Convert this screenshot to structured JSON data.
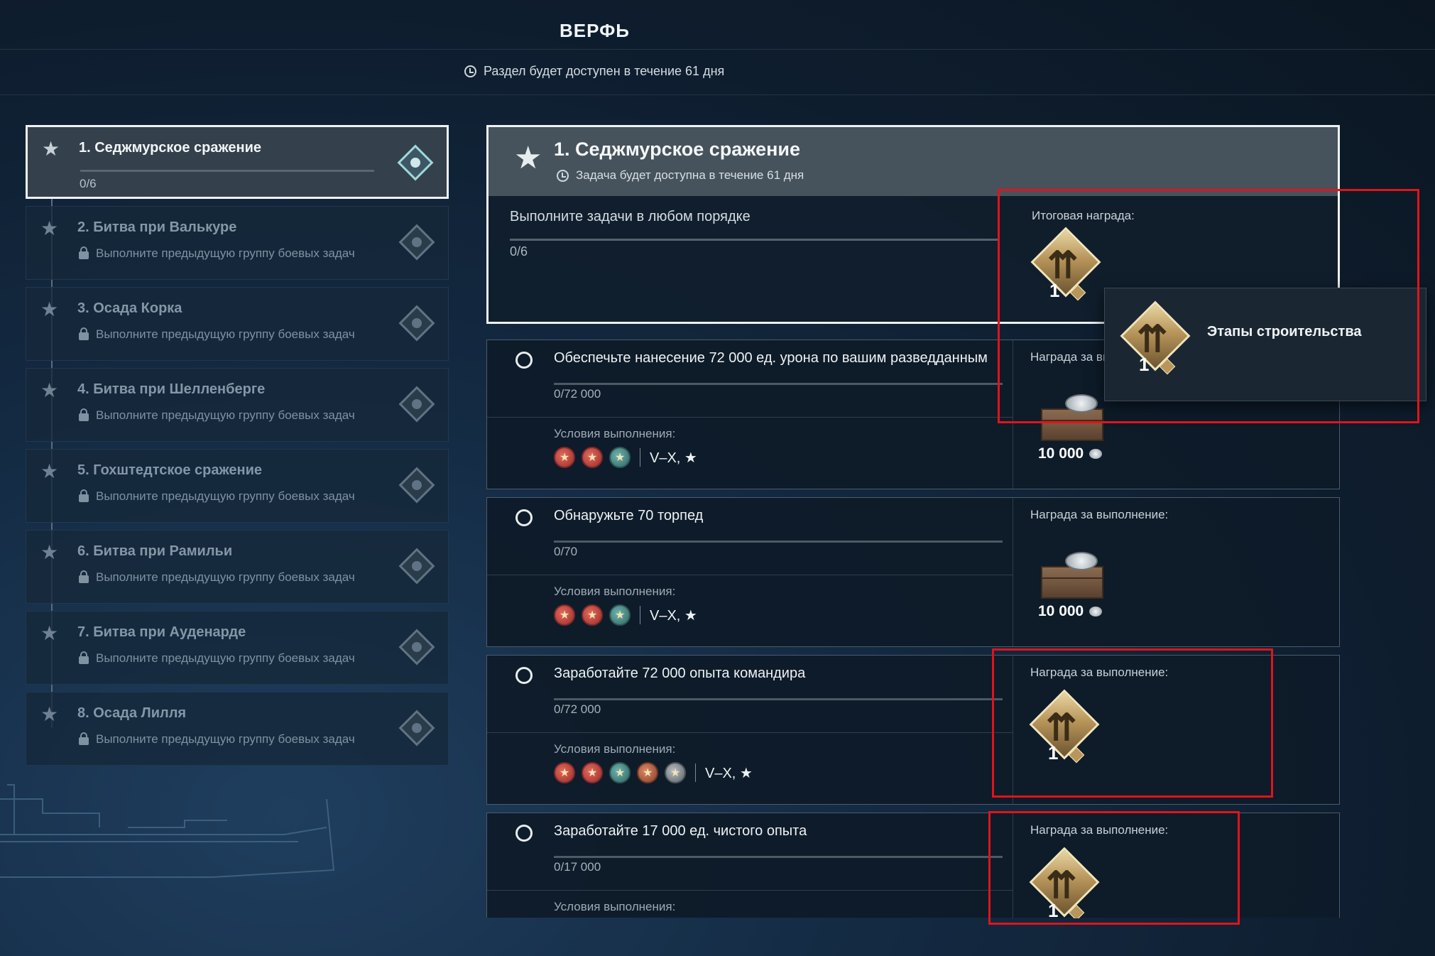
{
  "header": {
    "title": "ВЕРФЬ",
    "availability": "Раздел будет доступен в течение 61 дня"
  },
  "stages": [
    {
      "title": "1. Седжмурское сражение",
      "progress": "0/6",
      "progress_fraction": 0,
      "locked": false,
      "active": true,
      "lock_text": ""
    },
    {
      "title": "2. Битва при Валькуре",
      "progress": "",
      "locked": true,
      "active": false,
      "lock_text": "Выполните предыдущую группу боевых задач"
    },
    {
      "title": "3. Осада Корка",
      "progress": "",
      "locked": true,
      "active": false,
      "lock_text": "Выполните предыдущую группу боевых задач"
    },
    {
      "title": "4. Битва при Шелленберге",
      "progress": "",
      "locked": true,
      "active": false,
      "lock_text": "Выполните предыдущую группу боевых задач"
    },
    {
      "title": "5. Гохштедтское сражение",
      "progress": "",
      "locked": true,
      "active": false,
      "lock_text": "Выполните предыдущую группу боевых задач"
    },
    {
      "title": "6. Битва при Рамильи",
      "progress": "",
      "locked": true,
      "active": false,
      "lock_text": "Выполните предыдущую группу боевых задач"
    },
    {
      "title": "7. Битва при Ауденарде",
      "progress": "",
      "locked": true,
      "active": false,
      "lock_text": "Выполните предыдущую группу боевых задач"
    },
    {
      "title": "8. Осада Лилля",
      "progress": "",
      "locked": true,
      "active": false,
      "lock_text": "Выполните предыдущую группу боевых задач"
    }
  ],
  "detail": {
    "title": "1. Седжмурское сражение",
    "subtitle": "Задача будет доступна в течение 61 дня",
    "instruction": "Выполните задачи в любом порядке",
    "progress": "0/6",
    "progress_fraction": 0,
    "final_reward_label": "Итоговая награда:",
    "final_reward_count": "1"
  },
  "tasks": [
    {
      "title": "Обеспечьте нанесение 72 000 ед. урона по вашим разведданным",
      "progress": "0/72 000",
      "progress_fraction": 0,
      "conditions_label": "Условия выполнения:",
      "ship_types": [
        "destroyer-icon",
        "cruiser-icon",
        "battleship-icon"
      ],
      "tier": "V–X, ★",
      "reward_label": "Награда за выполнение:",
      "reward_type": "crate",
      "reward_amount": "10 000"
    },
    {
      "title": "Обнаружьте 70 торпед",
      "progress": "0/70",
      "progress_fraction": 0,
      "conditions_label": "Условия выполнения:",
      "ship_types": [
        "destroyer-icon",
        "cruiser-icon",
        "battleship-icon"
      ],
      "tier": "V–X, ★",
      "reward_label": "Награда за выполнение:",
      "reward_type": "crate",
      "reward_amount": "10 000"
    },
    {
      "title": "Заработайте 72 000 опыта командира",
      "progress": "0/72 000",
      "progress_fraction": 0,
      "conditions_label": "Условия выполнения:",
      "ship_types": [
        "destroyer-icon",
        "cruiser-icon",
        "battleship-icon",
        "submarine-icon",
        "aircraft-carrier-icon"
      ],
      "tier": "V–X, ★",
      "reward_label": "Награда за выполнение:",
      "reward_type": "emblem",
      "reward_amount": "1"
    },
    {
      "title": "Заработайте 17 000 ед. чистого опыта",
      "progress": "0/17 000",
      "progress_fraction": 0,
      "conditions_label": "Условия выполнения:",
      "ship_types": [],
      "tier": "",
      "reward_label": "Награда за выполнение:",
      "reward_type": "emblem",
      "reward_amount": "1"
    }
  ],
  "tooltip": {
    "text": "Этапы строительства",
    "count": "1"
  },
  "colors": {
    "highlight": "#e0141b",
    "active_border": "#eef2f4",
    "background": "#142b44"
  }
}
